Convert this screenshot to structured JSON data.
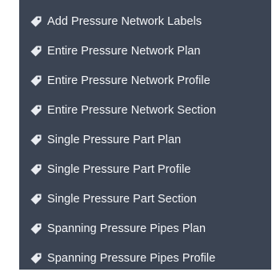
{
  "menu": {
    "icon": "tag-icon",
    "colors": {
      "background": "#3b4453",
      "text": "#f5f6f8",
      "icon": "#e9ecf1"
    },
    "items": [
      {
        "label": "Add Pressure Network Labels"
      },
      {
        "label": "Entire Pressure Network Plan"
      },
      {
        "label": "Entire Pressure Network Profile"
      },
      {
        "label": "Entire Pressure Network Section"
      },
      {
        "label": "Single Pressure Part Plan"
      },
      {
        "label": "Single Pressure Part Profile"
      },
      {
        "label": "Single Pressure Part Section"
      },
      {
        "label": "Spanning Pressure Pipes Plan"
      },
      {
        "label": "Spanning Pressure Pipes Profile"
      }
    ]
  }
}
